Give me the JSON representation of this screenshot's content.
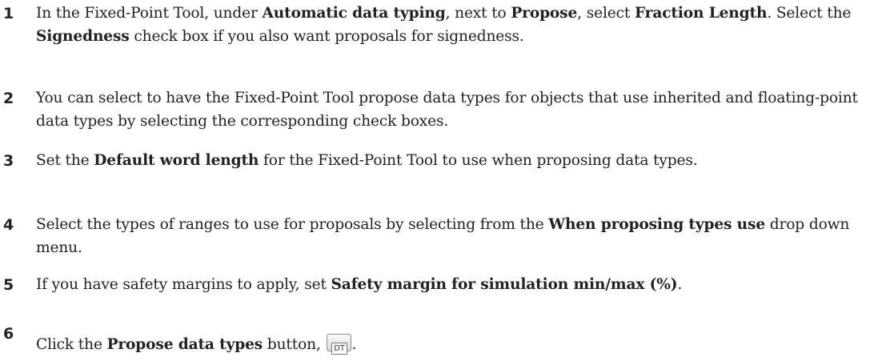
{
  "steps": [
    {
      "number": "1",
      "text_1": "In the Fixed-Point Tool, under ",
      "bold_1": "Automatic data typing",
      "text_2": ", next to ",
      "bold_2": "Propose",
      "text_3": ", select ",
      "bold_3": "Fraction Length",
      "text_4": ". Select the ",
      "bold_4": "Signedness",
      "text_5": " check box if you also want proposals for signedness."
    },
    {
      "number": "2",
      "text_1": "You can select to have the Fixed-Point Tool propose data types for objects that use inherited and floating-point data types by selecting the corresponding check boxes."
    },
    {
      "number": "3",
      "text_1": "Set the ",
      "bold_1": "Default word length",
      "text_2": " for the Fixed-Point Tool to use when proposing data types."
    },
    {
      "number": "4",
      "text_1": "Select the types of ranges to use for proposals by selecting from the ",
      "bold_1": "When proposing types use",
      "text_2": " drop down menu."
    },
    {
      "number": "5",
      "text_1": "If you have safety margins to apply, set ",
      "bold_1": "Safety margin for simulation min/max (%)",
      "text_2": "."
    },
    {
      "number": "6",
      "text_1": "Click the ",
      "bold_1": "Propose data types",
      "text_2": " button, ",
      "button_label": "DT",
      "text_3": "."
    }
  ]
}
